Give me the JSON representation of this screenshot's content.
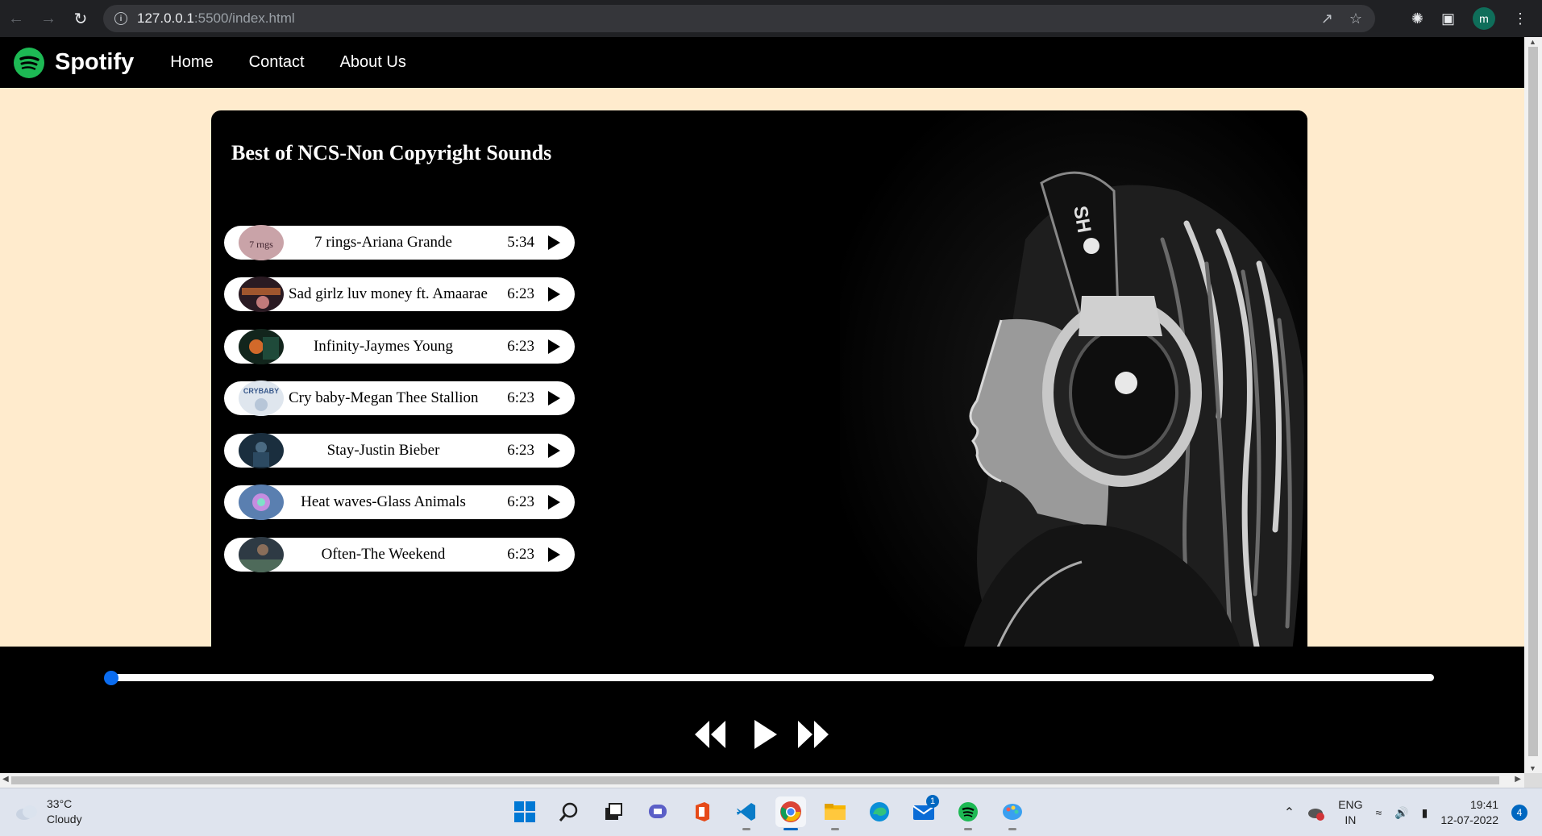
{
  "browser": {
    "url_host": "127.0.0.1",
    "url_path": ":5500/index.html",
    "profile_initial": "m"
  },
  "site": {
    "brand": "Spotify",
    "nav": [
      {
        "label": "Home"
      },
      {
        "label": "Contact"
      },
      {
        "label": "About Us"
      }
    ],
    "accent_color": "#1db954",
    "background_color": "#ffebcd"
  },
  "playlist": {
    "title": "Best of NCS-Non Copyright Sounds",
    "songs": [
      {
        "name": "7 rings-Ariana Grande",
        "duration": "5:34"
      },
      {
        "name": "Sad girlz luv money ft. Amaarae",
        "duration": "6:23"
      },
      {
        "name": "Infinity-Jaymes Young",
        "duration": "6:23"
      },
      {
        "name": "Cry baby-Megan Thee Stallion",
        "duration": "6:23"
      },
      {
        "name": "Stay-Justin Bieber",
        "duration": "6:23"
      },
      {
        "name": "Heat waves-Glass Animals",
        "duration": "6:23"
      },
      {
        "name": "Often-The Weekend",
        "duration": "6:23"
      }
    ]
  },
  "player": {
    "progress_percent": 0
  },
  "taskbar": {
    "temperature": "33°C",
    "weather": "Cloudy",
    "mail_badge": "1",
    "lang_line1": "ENG",
    "lang_line2": "IN",
    "time": "19:41",
    "date": "12-07-2022",
    "notification_count": "4"
  }
}
